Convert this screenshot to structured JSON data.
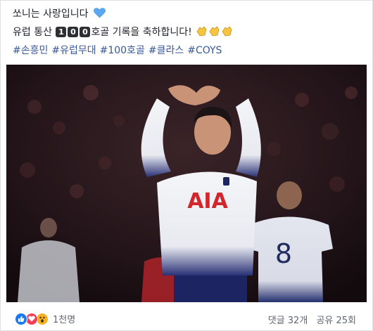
{
  "post": {
    "line1": "쏘니는 사랑입니다",
    "line2_prefix": "유럽 통산",
    "digits": [
      "1",
      "0",
      "0"
    ],
    "line2_suffix": "호골 기록을 축하합니다!",
    "hashtags": [
      "#손흥민",
      "#유럽무대",
      "#100호골",
      "#클라스",
      "#COYS"
    ]
  },
  "photo": {
    "jersey_sponsor": "AIA",
    "player_number": "8"
  },
  "footer": {
    "reaction_count": "1천명",
    "comments": "댓글 32개",
    "shares": "공유 25회"
  },
  "colors": {
    "hashtag": "#385898",
    "like": "#1877f2",
    "love": "#f33e58",
    "wow": "#f7b125"
  },
  "icons": [
    "blue-heart-icon",
    "clapping-hands-icon",
    "like-icon",
    "love-icon",
    "wow-icon"
  ]
}
